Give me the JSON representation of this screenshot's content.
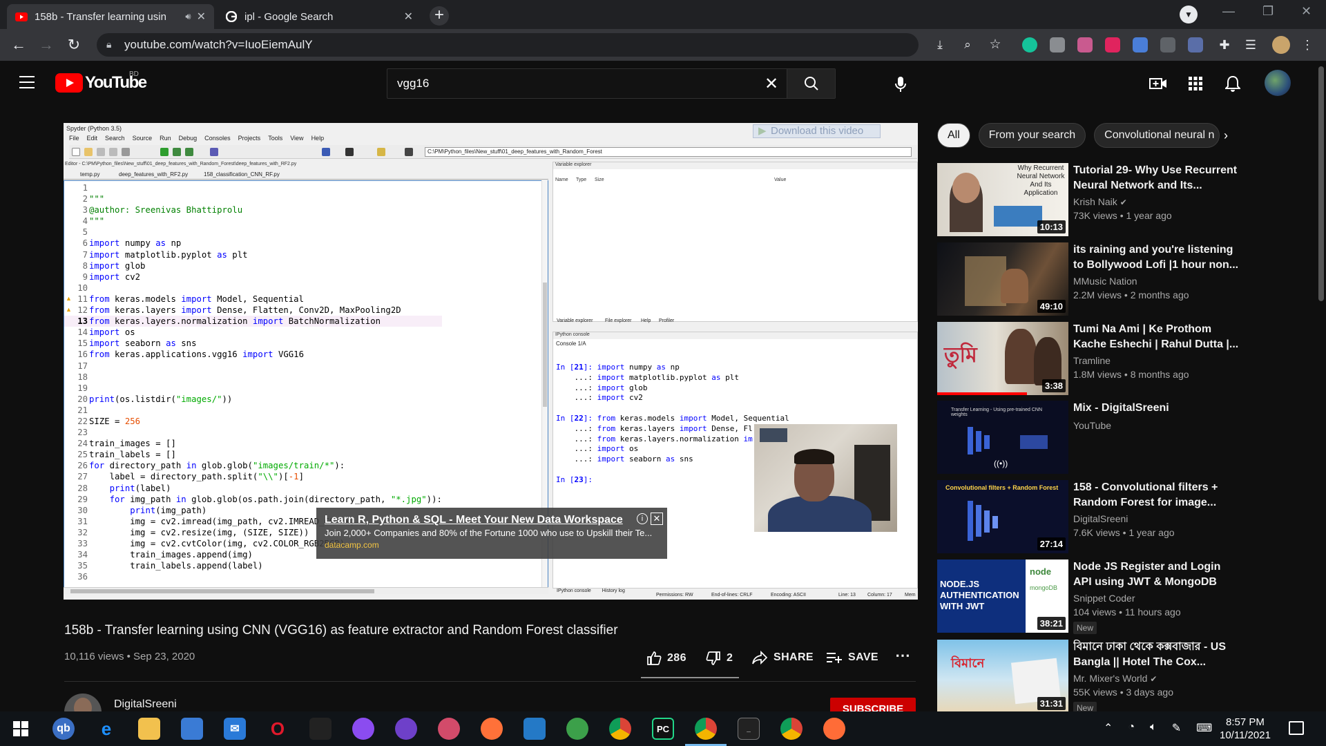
{
  "browser": {
    "tabs": [
      {
        "title": "158b - Transfer learning usin",
        "active": true,
        "icon": "youtube-icon",
        "audio": true
      },
      {
        "title": "ipl - Google Search",
        "active": false,
        "icon": "google-icon",
        "audio": false
      }
    ],
    "url": "youtube.com/watch?v=IuoEiemAulY"
  },
  "youtube": {
    "logo_text": "YouTube",
    "country": "BD",
    "search_value": "vgg16",
    "search_placeholder": "Search"
  },
  "player": {
    "window_title": "Spyder (Python 3.5)",
    "menu": [
      "File",
      "Edit",
      "Search",
      "Source",
      "Run",
      "Debug",
      "Consoles",
      "Projects",
      "Tools",
      "View",
      "Help"
    ],
    "path": "C:\\PM\\Python_files\\New_stuff\\01_deep_features_with_Random_Forest",
    "download_btn": "Download this video",
    "editor_path": "Editor - C:\\PM\\Python_files\\New_stuff\\01_deep_features_with_Random_Forest\\deep_features_with_RF2.py",
    "editor_tabs": [
      "temp.py",
      "deep_features_with_RF2.py",
      "158_classification_CNN_RF.py"
    ],
    "var_explorer_title": "Variable explorer",
    "var_cols": [
      "Name",
      "Type",
      "Size",
      "Value"
    ],
    "mid_tabs": [
      "Variable explorer",
      "File explorer",
      "Help",
      "Profiler"
    ],
    "console_title": "IPython console",
    "console_tab": "Console 1/A",
    "bottom_tabs": [
      "IPython console",
      "History log"
    ],
    "status": {
      "permissions": "Permissions: RW",
      "eol": "End-of-lines: CRLF",
      "encoding": "Encoding: ASCII",
      "line": "Line: 13",
      "column": "Column: 17",
      "mem": "Mem"
    },
    "ad": {
      "title": "Learn R, Python & SQL - Meet Your New Data Workspace",
      "desc": "Join 2,000+ Companies and 80% of the Fortune 1000 who use to Upskill their Te...",
      "url": "datacamp.com"
    }
  },
  "video": {
    "title": "158b - Transfer learning using CNN (VGG16) as feature extractor and Random Forest classifier",
    "stats": "10,116 views • Sep 23, 2020",
    "likes": "286",
    "dislikes": "2",
    "share": "SHARE",
    "save": "SAVE",
    "channel": "DigitalSreeni",
    "subscribe": "SUBSCRIBE"
  },
  "chips": [
    "All",
    "From your search",
    "Convolutional neural n"
  ],
  "recommendations": [
    {
      "title": "Tutorial 29- Why Use Recurrent Neural Network and Its...",
      "channel": "Krish Naik",
      "verified": true,
      "meta": "73K views • 1 year ago",
      "duration": "10:13",
      "thumb_text": "Why Recurrent Neural Network And Its Application",
      "new": ""
    },
    {
      "title": "its raining and you're listening to Bollywood Lofi |1 hour non...",
      "channel": "MMusic Nation",
      "verified": false,
      "meta": "2.2M views • 2 months ago",
      "duration": "49:10",
      "thumb_text": "",
      "new": ""
    },
    {
      "title": "Tumi Na Ami | Ke Prothom Kache Eshechi | Rahul Dutta |...",
      "channel": "Tramline",
      "verified": false,
      "meta": "1.8M views • 8 months ago",
      "duration": "3:38",
      "thumb_text": "",
      "new": ""
    },
    {
      "title": "Mix - DigitalSreeni",
      "channel": "YouTube",
      "verified": false,
      "meta": "",
      "duration": "",
      "thumb_text": "",
      "new": ""
    },
    {
      "title": "158 - Convolutional filters + Random Forest for image...",
      "channel": "DigitalSreeni",
      "verified": false,
      "meta": "7.6K views • 1 year ago",
      "duration": "27:14",
      "thumb_text": "Convolutional filters + Random Forest",
      "new": ""
    },
    {
      "title": "Node JS Register and Login API using JWT & MongoDB",
      "channel": "Snippet Coder",
      "verified": false,
      "meta": "104 views • 11 hours ago",
      "duration": "38:21",
      "thumb_text": "NODE.JS AUTHENTICATION WITH JWT",
      "new": "New"
    },
    {
      "title": "বিমানে ঢাকা থেকে কক্সবাজার - US Bangla || Hotel The Cox...",
      "channel": "Mr. Mixer's World",
      "verified": true,
      "meta": "55K views • 3 days ago",
      "duration": "31:31",
      "thumb_text": "",
      "new": "New"
    }
  ],
  "taskbar": {
    "time": "8:57 PM",
    "date": "10/11/2021"
  }
}
